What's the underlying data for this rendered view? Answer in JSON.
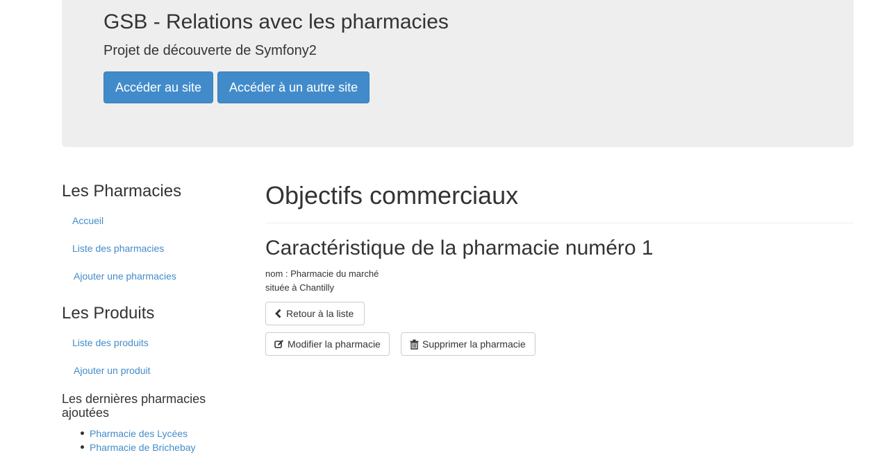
{
  "header": {
    "title": "GSB - Relations avec les pharmacies",
    "subtitle": "Projet de découverte de Symfony2",
    "btn_site": "Accéder au site",
    "btn_other": "Accéder à un autre site"
  },
  "sidebar": {
    "pharmacies_heading": "Les Pharmacies",
    "pharmacies_links": [
      "Accueil",
      "Liste des pharmacies",
      "Ajouter une pharmacies"
    ],
    "produits_heading": "Les Produits",
    "produits_links": [
      "Liste des produits",
      "Ajouter un produit"
    ],
    "recent_heading": "Les dernières pharmacies ajoutées",
    "recent_items": [
      "Pharmacie des Lycées",
      "Pharmacie de Brichebay"
    ]
  },
  "main": {
    "title": "Objectifs commerciaux",
    "subtitle": "Caractéristique de la pharmacie numéro 1",
    "nom_line": "nom : Pharmacie du marché",
    "ville_line": "située à Chantilly",
    "btn_back": "Retour à la liste",
    "btn_edit": "Modifier la pharmacie",
    "btn_delete": "Supprimer la pharmacie"
  },
  "colors": {
    "link": "#428bca",
    "primary": "#428bca",
    "jumbotron": "#eeeeee"
  },
  "icons": [
    "chevron-left-icon",
    "edit-icon",
    "trash-icon"
  ]
}
